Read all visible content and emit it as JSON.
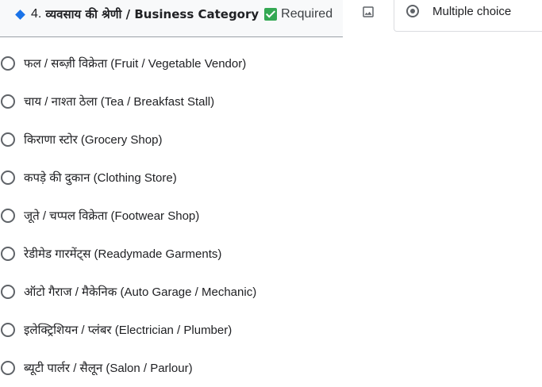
{
  "question": {
    "number": "4.",
    "title": "व्यवसाय की श्रेणी / Business Category",
    "required_label": "Required",
    "type_label": "Multiple choice"
  },
  "options": [
    {
      "label": "फल / सब्ज़ी विक्रेता (Fruit / Vegetable Vendor)"
    },
    {
      "label": "चाय / नाश्ता ठेला (Tea / Breakfast Stall)"
    },
    {
      "label": "किराणा स्टोर (Grocery Shop)"
    },
    {
      "label": "कपड़े की दुकान (Clothing Store)"
    },
    {
      "label": "जूते / चप्पल विक्रेता (Footwear Shop)"
    },
    {
      "label": "रेडीमेड गारमेंट्स (Readymade Garments)"
    },
    {
      "label": "ऑटो गैराज / मैकेनिक (Auto Garage / Mechanic)"
    },
    {
      "label": "इलेक्ट्रिशियन / प्लंबर (Electrician / Plumber)"
    },
    {
      "label": "ब्यूटी पार्लर / सैलून (Salon / Parlour)"
    }
  ],
  "icons": {
    "diamond": "diamond-icon",
    "required": "checkbox-checked-icon",
    "image": "image-icon",
    "type": "radio-selected-icon"
  },
  "colors": {
    "accent": "#1a73e8",
    "required_check": "#34a853",
    "radio_border": "#5f6368"
  }
}
